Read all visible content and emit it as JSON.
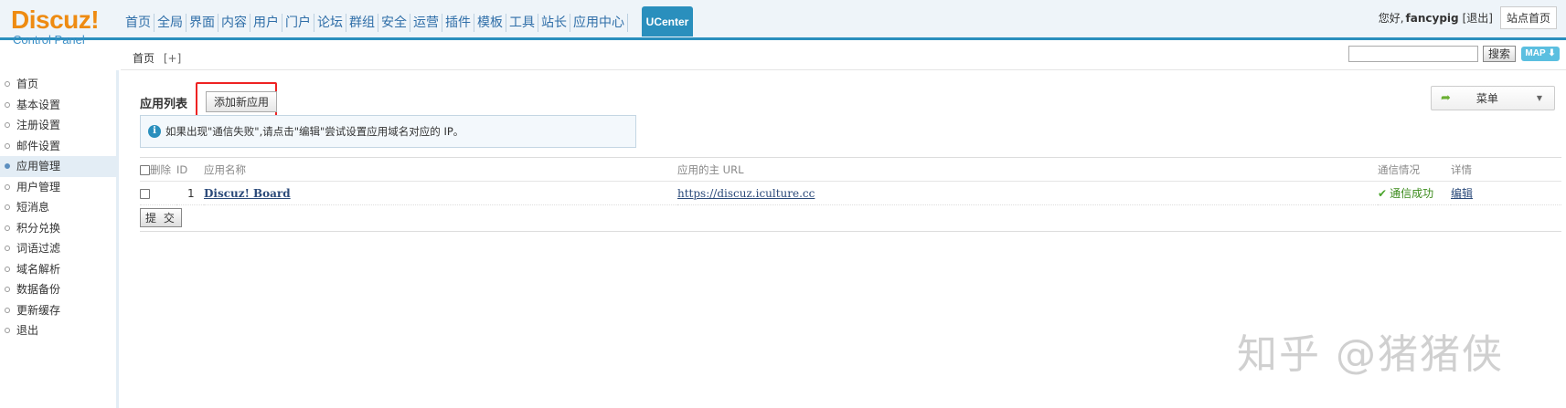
{
  "logo": {
    "main": "Discuz!",
    "sub": "Control Panel"
  },
  "topnav": {
    "items": [
      "首页",
      "全局",
      "界面",
      "内容",
      "用户",
      "门户",
      "论坛",
      "群组",
      "安全",
      "运营",
      "插件",
      "模板",
      "工具",
      "站长",
      "应用中心"
    ],
    "active": "UCenter"
  },
  "user": {
    "greeting": "您好,",
    "name": "fancypig",
    "logout": "[退出]",
    "home": "站点首页"
  },
  "subbar": {
    "breadcrumb": "首页",
    "add_shortcut": "[+]",
    "search_placeholder": "",
    "search_button": "搜索",
    "map_button": "MAP ⬇"
  },
  "sidebar": {
    "items": [
      {
        "label": "首页",
        "active": false
      },
      {
        "label": "基本设置",
        "active": false
      },
      {
        "label": "注册设置",
        "active": false
      },
      {
        "label": "邮件设置",
        "active": false
      },
      {
        "label": "应用管理",
        "active": true
      },
      {
        "label": "用户管理",
        "active": false
      },
      {
        "label": "短消息",
        "active": false
      },
      {
        "label": "积分兑换",
        "active": false
      },
      {
        "label": "词语过滤",
        "active": false
      },
      {
        "label": "域名解析",
        "active": false
      },
      {
        "label": "数据备份",
        "active": false
      },
      {
        "label": "更新缓存",
        "active": false
      },
      {
        "label": "退出",
        "active": false
      }
    ]
  },
  "main": {
    "title": "应用列表",
    "add_button": "添加新应用",
    "tip": "如果出现\"通信失败\",请点击\"编辑\"尝试设置应用域名对应的 IP。",
    "menu_label": "菜单",
    "table": {
      "headers": {
        "del": "删除",
        "id": "ID",
        "name": "应用名称",
        "url": "应用的主 URL",
        "status": "通信情况",
        "detail": "详情"
      },
      "rows": [
        {
          "id": "1",
          "name": "Discuz! Board",
          "url": "https://discuz.iculture.cc",
          "status": "通信成功",
          "detail": "编辑"
        }
      ]
    },
    "submit": "提 交"
  },
  "watermark": "知乎 @猪猪侠",
  "colors": {
    "accent": "#2a8fbd",
    "logo_orange": "#ee8b12",
    "highlight_red": "#e22222"
  }
}
